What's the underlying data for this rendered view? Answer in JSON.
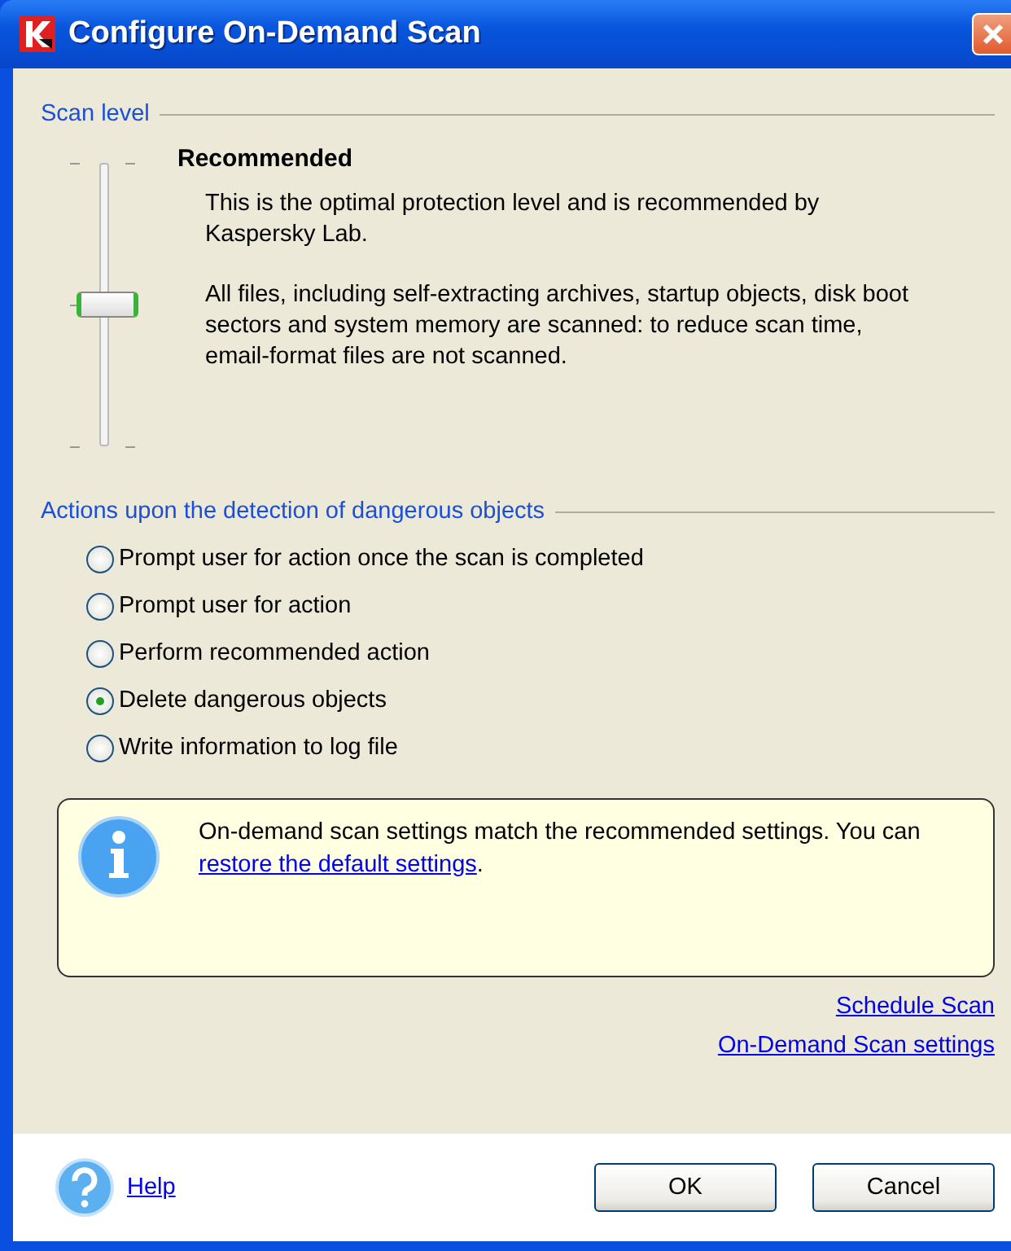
{
  "window": {
    "title": "Configure On-Demand Scan"
  },
  "scan_level": {
    "legend": "Scan level",
    "slider": {
      "level": 0.5
    },
    "name": "Recommended",
    "paragraphs": [
      "This is the optimal protection level and is recommended by Kaspersky Lab.",
      "All files, including self-extracting archives, startup objects, disk boot sectors and system memory are scanned: to reduce scan time, email-format files are not scanned."
    ]
  },
  "actions": {
    "legend": "Actions upon the detection of dangerous objects",
    "options": [
      {
        "label": "Prompt user for action once the scan is completed",
        "selected": false
      },
      {
        "label": "Prompt user for action",
        "selected": false
      },
      {
        "label": "Perform recommended action",
        "selected": false
      },
      {
        "label": "Delete dangerous objects",
        "selected": true
      },
      {
        "label": "Write information to log file",
        "selected": false
      }
    ]
  },
  "info": {
    "text": "On-demand scan settings match the recommended settings. You can",
    "link": "restore the default settings",
    "suffix": "."
  },
  "links": [
    "Schedule Scan",
    "On-Demand Scan settings"
  ],
  "footer": {
    "help": "Help",
    "buttons": [
      "OK",
      "Cancel"
    ]
  }
}
